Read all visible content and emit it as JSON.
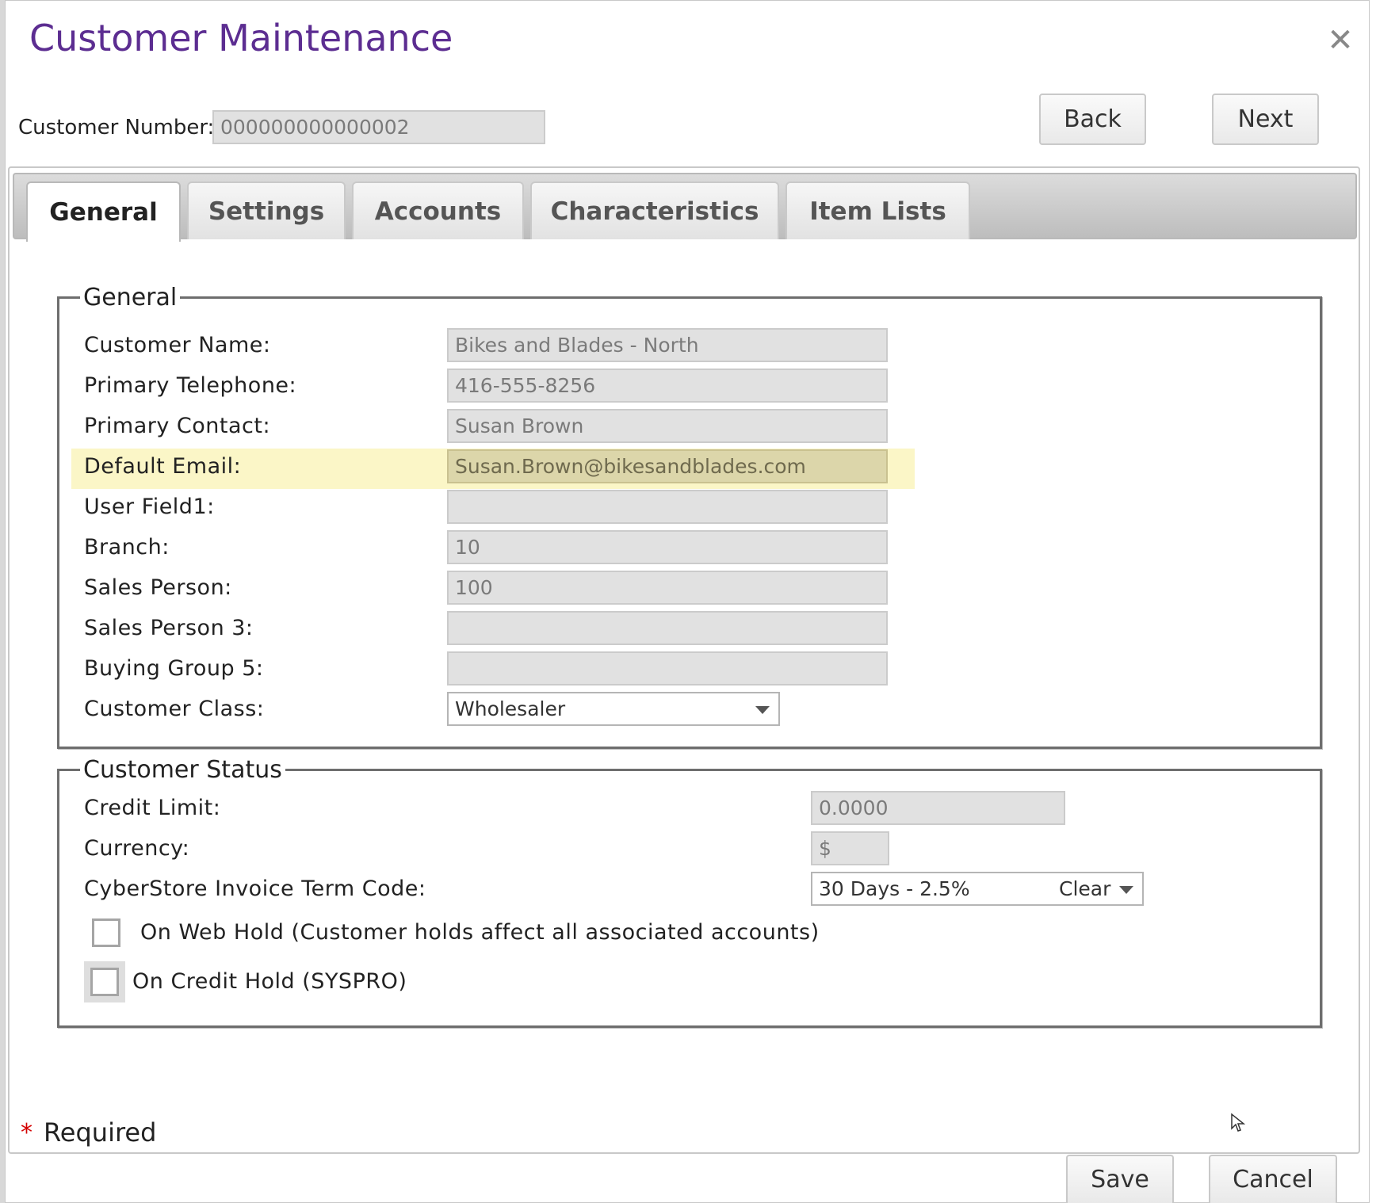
{
  "dialog": {
    "title": "Customer Maintenance",
    "close_icon": "close-icon"
  },
  "header": {
    "customer_number_label": "Customer Number:",
    "customer_number_value": "000000000000002",
    "back_label": "Back",
    "next_label": "Next"
  },
  "tabs": [
    {
      "label": "General",
      "active": true
    },
    {
      "label": "Settings",
      "active": false
    },
    {
      "label": "Accounts",
      "active": false
    },
    {
      "label": "Characteristics",
      "active": false
    },
    {
      "label": "Item Lists",
      "active": false
    }
  ],
  "general": {
    "legend": "General",
    "fields": {
      "customer_name": {
        "label": "Customer Name:",
        "value": "Bikes and Blades - North"
      },
      "primary_telephone": {
        "label": "Primary Telephone:",
        "value": "416-555-8256"
      },
      "primary_contact": {
        "label": "Primary Contact:",
        "value": "Susan Brown"
      },
      "default_email": {
        "label": "Default Email:",
        "value": "Susan.Brown@bikesandblades.com"
      },
      "user_field1": {
        "label": "User Field1:",
        "value": ""
      },
      "branch": {
        "label": "Branch:",
        "value": "10"
      },
      "sales_person": {
        "label": "Sales Person:",
        "value": "100"
      },
      "sales_person_3": {
        "label": "Sales Person 3:",
        "value": ""
      },
      "buying_group_5": {
        "label": "Buying Group 5:",
        "value": ""
      },
      "customer_class": {
        "label": "Customer Class:",
        "value": "Wholesaler"
      }
    }
  },
  "status": {
    "legend": "Customer Status",
    "credit_limit": {
      "label": "Credit Limit:",
      "value": "0.0000"
    },
    "currency": {
      "label": "Currency:",
      "value": "$"
    },
    "term_code": {
      "label": "CyberStore Invoice Term Code:",
      "value": "30 Days - 2.5%",
      "clear_label": "Clear"
    },
    "web_hold": {
      "label": "On Web Hold (Customer holds affect all associated accounts)",
      "checked": false
    },
    "credit_hold": {
      "label": "On Credit Hold (SYSPRO)",
      "checked": false
    }
  },
  "footer": {
    "required_star": "*",
    "required_label": "Required",
    "save_label": "Save",
    "cancel_label": "Cancel"
  },
  "colors": {
    "title": "#5c2d91",
    "highlight": "#fbf6c7",
    "required_star": "#d40000"
  }
}
